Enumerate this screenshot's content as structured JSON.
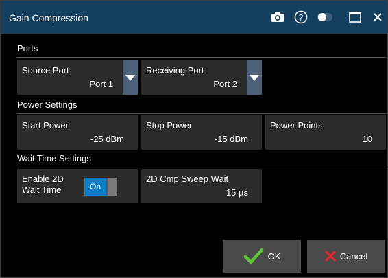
{
  "window": {
    "title": "Gain Compression",
    "icons": [
      "camera-icon",
      "help-icon",
      "toggle-dot-icon",
      "maximize-icon",
      "close-icon"
    ]
  },
  "sections": {
    "ports": "Ports",
    "power": "Power Settings",
    "wait": "Wait Time Settings"
  },
  "ports": {
    "source_label": "Source Port",
    "source_value": "Port 1",
    "receiving_label": "Receiving Port",
    "receiving_value": "Port 2"
  },
  "power": {
    "start_label": "Start Power",
    "start_value": "-25 dBm",
    "stop_label": "Stop Power",
    "stop_value": "-15 dBm",
    "points_label": "Power Points",
    "points_value": "10"
  },
  "wait": {
    "enable_label": "Enable 2D Wait Time",
    "toggle_state": "On",
    "sweep_label": "2D Cmp Sweep Wait",
    "sweep_value": "15 µs"
  },
  "buttons": {
    "ok": "OK",
    "cancel": "Cancel"
  },
  "colors": {
    "titlebar": "#143f5f",
    "accent": "#0e7ec5",
    "ok_check": "#5fc63a",
    "cancel_x": "#e2262b"
  }
}
